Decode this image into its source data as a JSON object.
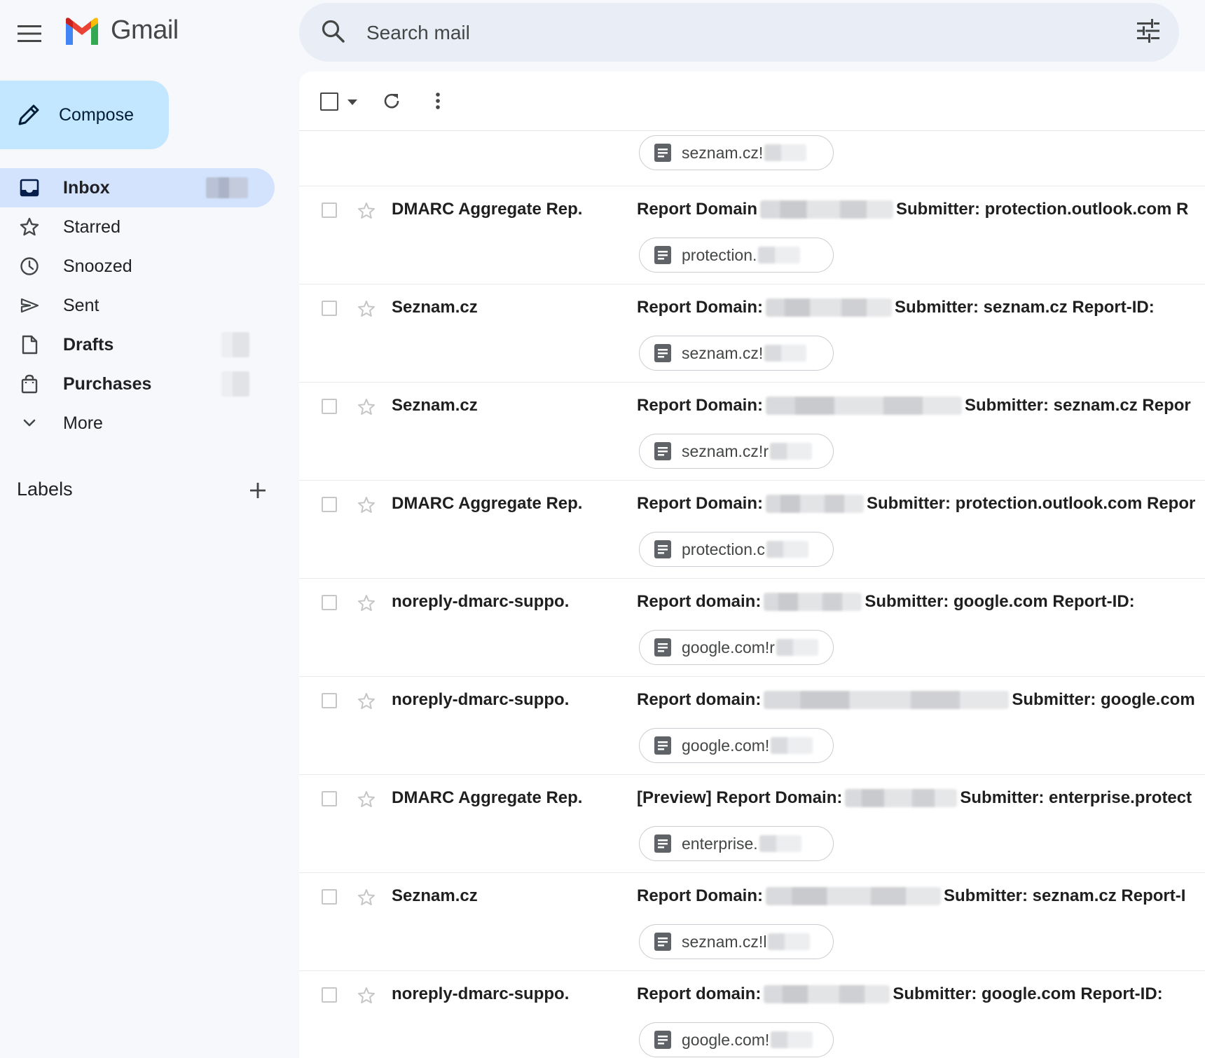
{
  "app": {
    "name": "Gmail"
  },
  "search": {
    "placeholder": "Search mail"
  },
  "compose": {
    "label": "Compose"
  },
  "nav": {
    "items": [
      {
        "label": "Inbox",
        "icon": "inbox-icon",
        "bold": true,
        "active": true
      },
      {
        "label": "Starred",
        "icon": "star-icon"
      },
      {
        "label": "Snoozed",
        "icon": "clock-icon"
      },
      {
        "label": "Sent",
        "icon": "send-icon"
      },
      {
        "label": "Drafts",
        "icon": "draft-icon",
        "bold": true
      },
      {
        "label": "Purchases",
        "icon": "shopping-bag-icon",
        "bold": true
      },
      {
        "label": "More",
        "icon": "chevron-down-icon"
      }
    ]
  },
  "labels": {
    "title": "Labels"
  },
  "emails": [
    {
      "sender": "",
      "subject_pre": "",
      "subject_post": "",
      "attachment": "seznam.cz!"
    },
    {
      "sender": "DMARC Aggregate Rep.",
      "subject_pre": "Report Domain",
      "subject_post": "Submitter: protection.outlook.com R",
      "attachment": "protection."
    },
    {
      "sender": "Seznam.cz",
      "subject_pre": "Report Domain:",
      "subject_post": "Submitter: seznam.cz Report-ID:",
      "attachment": "seznam.cz!"
    },
    {
      "sender": "Seznam.cz",
      "subject_pre": "Report Domain:",
      "subject_post": "Submitter: seznam.cz Repor",
      "attachment": "seznam.cz!r"
    },
    {
      "sender": "DMARC Aggregate Rep.",
      "subject_pre": "Report Domain:",
      "subject_post": "Submitter: protection.outlook.com Repor",
      "attachment": "protection.c"
    },
    {
      "sender": "noreply-dmarc-suppo.",
      "subject_pre": "Report domain:",
      "subject_post": "Submitter: google.com Report-ID:",
      "attachment": "google.com!r"
    },
    {
      "sender": "noreply-dmarc-suppo.",
      "subject_pre": "Report domain:",
      "subject_post": "Submitter: google.com",
      "attachment": "google.com!"
    },
    {
      "sender": "DMARC Aggregate Rep.",
      "subject_pre": "[Preview] Report Domain:",
      "subject_post": "Submitter: enterprise.protect",
      "attachment": "enterprise."
    },
    {
      "sender": "Seznam.cz",
      "subject_pre": "Report Domain:",
      "subject_post": "Submitter: seznam.cz Report-I",
      "attachment": "seznam.cz!l"
    },
    {
      "sender": "noreply-dmarc-suppo.",
      "subject_pre": "Report domain:",
      "subject_post": "Submitter: google.com Report-ID:",
      "attachment": "google.com!"
    }
  ],
  "colors": {
    "compose_bg": "#c2e7ff",
    "active_nav_bg": "#d3e3fd",
    "search_bg": "#e9eef6",
    "page_bg": "#f6f8fc"
  }
}
